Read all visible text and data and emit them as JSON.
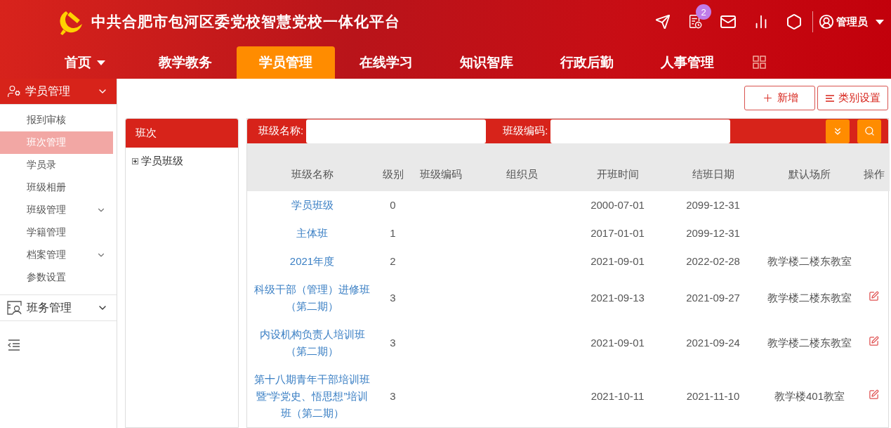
{
  "header": {
    "title": "中共合肥市包河区委党校智慧党校一体化平台",
    "notification_count": "2",
    "user": "管理员"
  },
  "nav": [
    {
      "label": "首页",
      "selected": false,
      "has_menu": true
    },
    {
      "label": "教学教务",
      "selected": false,
      "has_menu": false
    },
    {
      "label": "学员管理",
      "selected": true,
      "has_menu": false
    },
    {
      "label": "在线学习",
      "selected": false,
      "has_menu": false
    },
    {
      "label": "知识智库",
      "selected": false,
      "has_menu": false
    },
    {
      "label": "行政后勤",
      "selected": false,
      "has_menu": false
    },
    {
      "label": "人事管理",
      "selected": false,
      "has_menu": false
    }
  ],
  "sidebar": {
    "groups": [
      {
        "label": "学员管理",
        "expanded": true,
        "kind": "students",
        "items": [
          {
            "label": "报到审核",
            "selected": false,
            "has_children": false
          },
          {
            "label": "班次管理",
            "selected": true,
            "has_children": false
          },
          {
            "label": "学员录",
            "selected": false,
            "has_children": false
          },
          {
            "label": "班级相册",
            "selected": false,
            "has_children": false
          },
          {
            "label": "班级管理",
            "selected": false,
            "has_children": true
          },
          {
            "label": "学籍管理",
            "selected": false,
            "has_children": false
          },
          {
            "label": "档案管理",
            "selected": false,
            "has_children": true
          },
          {
            "label": "参数设置",
            "selected": false,
            "has_children": false
          }
        ]
      },
      {
        "label": "班务管理",
        "expanded": false,
        "kind": "roster"
      }
    ]
  },
  "toolbar": {
    "buttons": [
      {
        "label": "新增",
        "kind": "add"
      },
      {
        "label": "类别设置",
        "kind": "category"
      }
    ]
  },
  "tree": {
    "title": "班次",
    "nodes": [
      {
        "label": "学员班级",
        "expanded": false
      }
    ]
  },
  "search": {
    "fields": [
      {
        "label": "班级名称:"
      },
      {
        "label": "班级编码:"
      }
    ]
  },
  "table": {
    "columns": [
      "班级名称",
      "级别",
      "班级编码",
      "组织员",
      "开班时间",
      "结班日期",
      "默认场所",
      "操作"
    ],
    "rows": [
      {
        "name": "学员班级",
        "level": "0",
        "start": "2000-07-01",
        "end": "2099-12-31",
        "editable": false
      },
      {
        "name": "主体班",
        "level": "1",
        "start": "2017-01-01",
        "end": "2099-12-31",
        "editable": false
      },
      {
        "name": "2021年度",
        "level": "2",
        "start": "2021-09-01",
        "end": "2022-02-28",
        "location": "教学楼二楼东教室",
        "editable": false
      },
      {
        "name": "科级干部（管理）进修班（第二期）",
        "level": "3",
        "start": "2021-09-13",
        "end": "2021-09-27",
        "location": "教学楼二楼东教室",
        "editable": true
      },
      {
        "name": "内设机构负责人培训班（第二期）",
        "level": "3",
        "start": "2021-09-01",
        "end": "2021-09-24",
        "location": "教学楼二楼东教室",
        "editable": true
      },
      {
        "name": "第十八期青年干部培训班暨“学党史、悟思想”培训班（第二期）",
        "level": "3",
        "start": "2021-10-11",
        "end": "2021-11-10",
        "location": "教学楼401教室",
        "editable": true
      }
    ]
  }
}
